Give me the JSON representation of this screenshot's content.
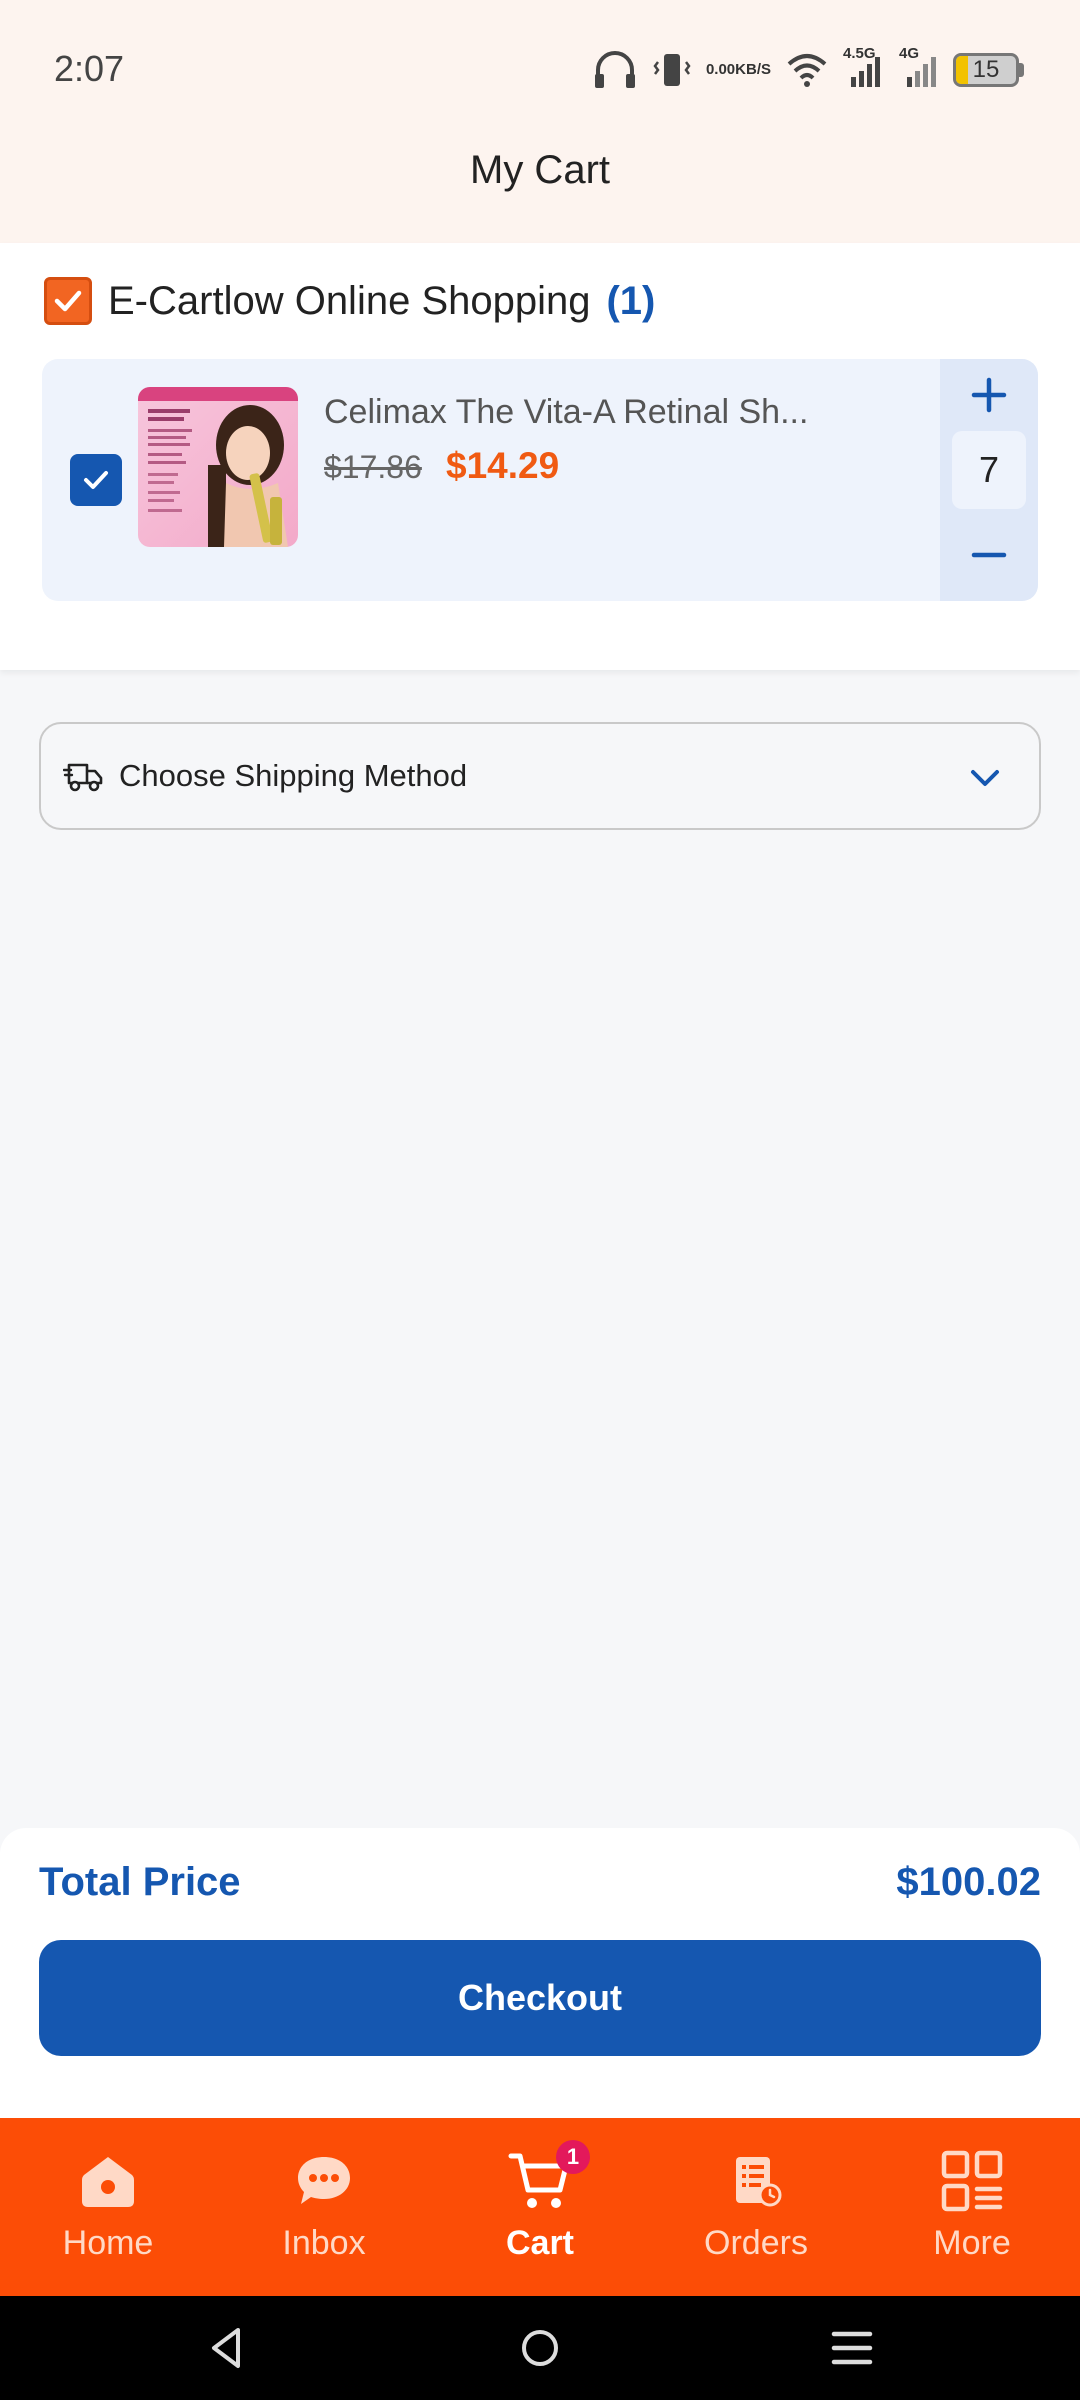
{
  "status_bar": {
    "time": "2:07",
    "net_speed_value": "0.00",
    "net_speed_unit": "KB/S",
    "network_1": "4.5G",
    "network_2": "4G",
    "battery_level": "15"
  },
  "header": {
    "title": "My Cart"
  },
  "store": {
    "name": "E-Cartlow Online Shopping",
    "count": "(1)",
    "checked": true
  },
  "cart_item": {
    "name": "Celimax The Vita-A Retinal Sh...",
    "old_price": "$17.86",
    "price": "$14.29",
    "quantity": "7",
    "checked": true
  },
  "shipping": {
    "label": "Choose Shipping Method"
  },
  "summary": {
    "total_label": "Total Price",
    "total_value": "$100.02",
    "checkout_label": "Checkout"
  },
  "bottom_nav": {
    "items": [
      {
        "label": "Home",
        "icon": "home-icon"
      },
      {
        "label": "Inbox",
        "icon": "chat-icon"
      },
      {
        "label": "Cart",
        "icon": "cart-icon",
        "badge": "1",
        "active": true
      },
      {
        "label": "Orders",
        "icon": "orders-icon"
      },
      {
        "label": "More",
        "icon": "grid-icon"
      }
    ]
  },
  "colors": {
    "brand_orange": "#fc4d06",
    "brand_blue": "#1557b0",
    "price_orange": "#f05a12"
  }
}
